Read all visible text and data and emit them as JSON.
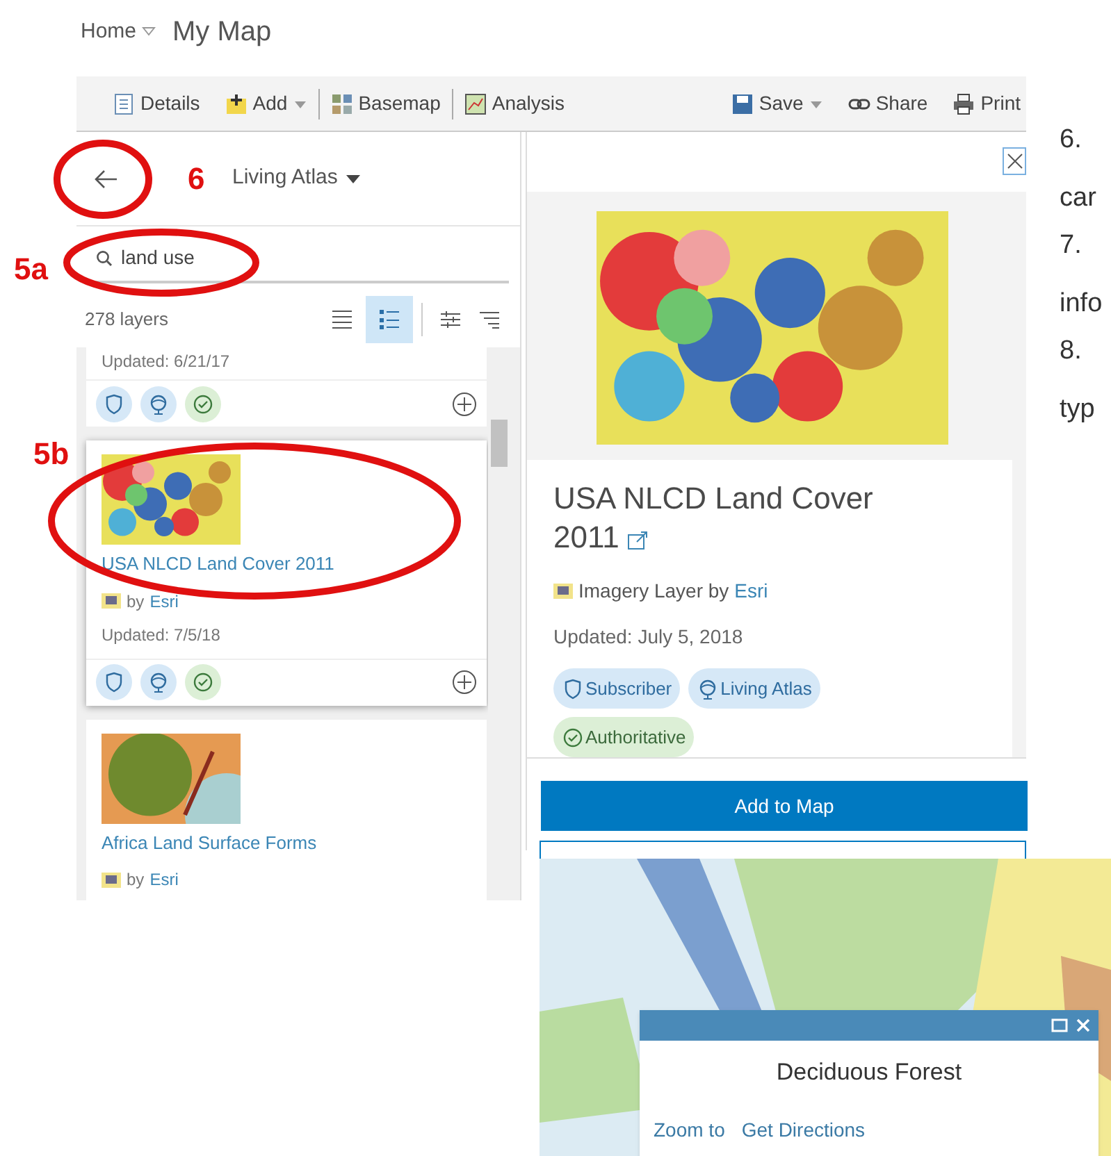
{
  "breadcrumb": {
    "home": "Home",
    "title": "My Map"
  },
  "toolbar": {
    "items": [
      {
        "kind": "details",
        "label": "Details",
        "dropdown": false
      },
      {
        "kind": "add",
        "label": "Add",
        "dropdown": true
      },
      {
        "kind": "basemap",
        "label": "Basemap",
        "dropdown": false
      },
      {
        "kind": "analysis",
        "label": "Analysis",
        "dropdown": false
      },
      {
        "kind": "save",
        "label": "Save",
        "dropdown": true
      },
      {
        "kind": "share",
        "label": "Share",
        "dropdown": false
      },
      {
        "kind": "print",
        "label": "Print",
        "dropdown": false
      }
    ]
  },
  "browse_panel": {
    "source": "Living Atlas",
    "search": {
      "value": "land use"
    },
    "count": "278 layers",
    "views": [
      {
        "kind": "list",
        "selected": false
      },
      {
        "kind": "detail",
        "selected": true
      }
    ],
    "results": [
      {
        "kind": "partial",
        "updated": "Updated: 6/21/17",
        "selected": false,
        "badges": [
          {
            "kind": "subscriber"
          },
          {
            "kind": "living_atlas"
          },
          {
            "kind": "authoritative"
          }
        ]
      },
      {
        "kind": "landcover",
        "title": "USA NLCD Land Cover 2011",
        "by": "by",
        "owner": "Esri",
        "updated": "Updated: 7/5/18",
        "selected": true,
        "badges": [
          {
            "kind": "subscriber"
          },
          {
            "kind": "living_atlas"
          },
          {
            "kind": "authoritative"
          }
        ]
      },
      {
        "kind": "terrain",
        "title": "Africa Land Surface Forms",
        "by": "by",
        "owner": "Esri",
        "selected": false
      }
    ]
  },
  "detail_panel": {
    "title": "USA NLCD Land Cover 2011",
    "type": "Imagery Layer by",
    "owner": "Esri",
    "updated": "Updated: July 5, 2018",
    "tags": [
      {
        "kind": "subscriber",
        "label": "Subscriber"
      },
      {
        "kind": "living_atlas",
        "label": "Living Atlas"
      },
      {
        "kind": "authoritative",
        "label": "Authoritative"
      }
    ],
    "button": "Add to Map"
  },
  "side_notes": [
    "6.",
    "car",
    "7.",
    "info",
    "8.",
    "typ"
  ],
  "annotations": [
    {
      "kind": "back",
      "label": "6"
    },
    {
      "kind": "search",
      "label": "5a"
    },
    {
      "kind": "result",
      "label": "5b"
    }
  ],
  "popup": {
    "title": "Deciduous Forest",
    "actions": [
      "Zoom to",
      "Get Directions"
    ]
  }
}
